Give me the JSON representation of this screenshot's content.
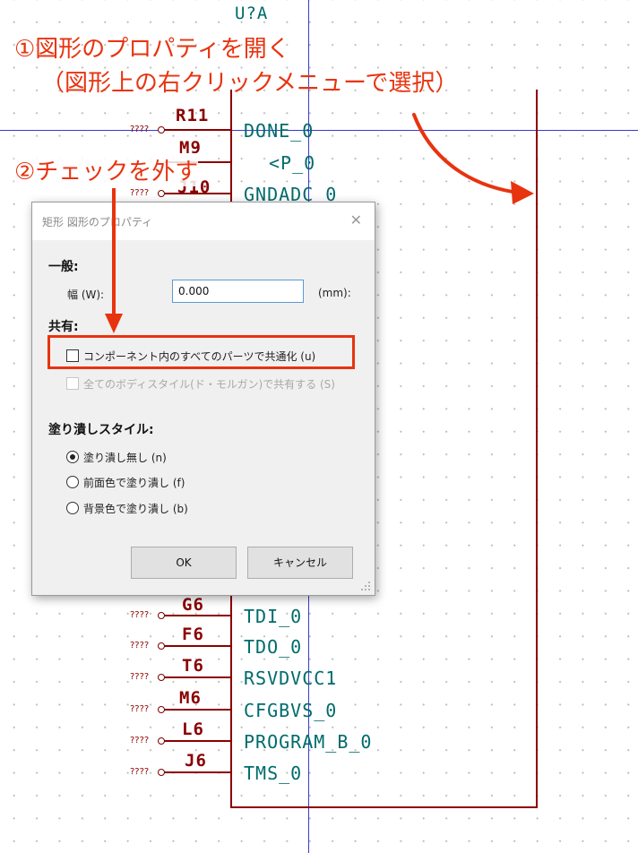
{
  "annotations": {
    "step1_line1": "①図形のプロパティを開く",
    "step1_line2": "（図形上の右クリックメニューで選択）",
    "step2": "②チェックを外す"
  },
  "colors": {
    "annotation": "#e8330f",
    "component_outline": "#8b0000",
    "pin_name": "#006b6b",
    "crosshair": "#3a3acc"
  },
  "schematic": {
    "reference": "U?A",
    "unconnected_marker": "????",
    "pins_top": [
      {
        "num": "R11",
        "name": "DONE_0"
      },
      {
        "num": "M9",
        "name": "<P_0"
      },
      {
        "num": "J10",
        "name": "GNDADC_0"
      }
    ],
    "pins_bottom": [
      {
        "num": "G6",
        "name": "TDI_0"
      },
      {
        "num": "F6",
        "name": "TDO_0"
      },
      {
        "num": "T6",
        "name": "RSVDVCC1"
      },
      {
        "num": "M6",
        "name": "CFGBVS_0"
      },
      {
        "num": "L6",
        "name": "PROGRAM_B_0"
      },
      {
        "num": "J6",
        "name": "TMS_0"
      }
    ]
  },
  "dialog": {
    "title": "矩形 図形のプロパティ",
    "close_icon": "close-icon",
    "general": {
      "heading": "一般:",
      "width_label": "幅 (W):",
      "width_value": "0.000",
      "width_unit": "(mm):"
    },
    "shared": {
      "heading": "共有:",
      "common_to_all_parts": {
        "label": "コンポーネント内のすべてのパーツで共通化 (u)",
        "checked": false,
        "enabled": true
      },
      "share_body_styles": {
        "label": "全てのボディスタイル(ド・モルガン)で共有する (S)",
        "checked": false,
        "enabled": false
      }
    },
    "fill": {
      "heading": "塗り潰しスタイル:",
      "options": [
        {
          "label": "塗り潰し無し (n)",
          "selected": true
        },
        {
          "label": "前面色で塗り潰し (f)",
          "selected": false
        },
        {
          "label": "背景色で塗り潰し (b)",
          "selected": false
        }
      ]
    },
    "ok_label": "OK",
    "cancel_label": "キャンセル"
  }
}
